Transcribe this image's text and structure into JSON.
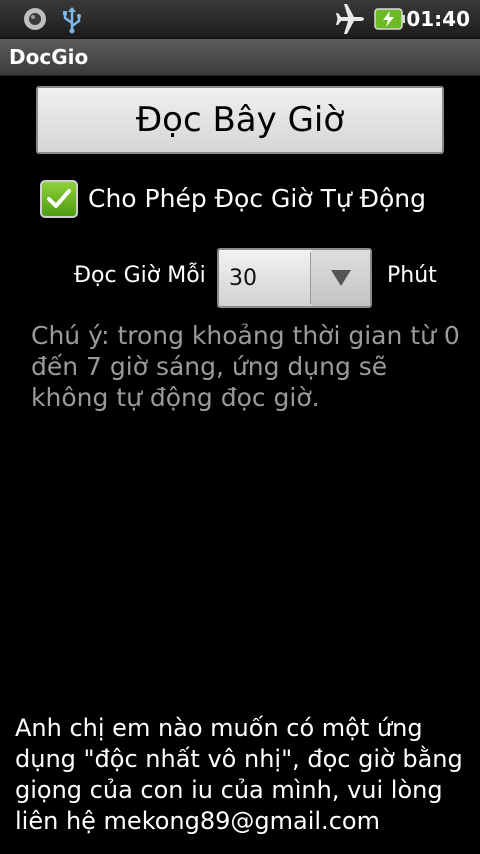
{
  "status_bar": {
    "time": "01:40"
  },
  "app": {
    "title": "DocGio"
  },
  "main": {
    "read_now_label": "Đọc Bây Giờ",
    "auto_read_label": "Cho Phép Đọc Giờ Tự Động",
    "auto_read_checked": true,
    "interval_label": "Đọc Giờ Mỗi",
    "interval_value": "30",
    "interval_unit": "Phút",
    "note": "Chú ý: trong khoảng thời gian từ 0 đến 7 giờ sáng, ứng dụng sẽ không tự động đọc giờ.",
    "contact": "Anh chị em nào muốn có một ứng dụng \"độc nhất vô nhị\", đọc giờ bằng giọng của con iu của mình, vui lòng liên hệ mekong89@gmail.com"
  },
  "icons": {
    "status_left": [
      "camera-icon",
      "usb-icon"
    ],
    "status_right": [
      "airplane-mode-icon",
      "battery-charging-icon"
    ]
  },
  "colors": {
    "background": "#000000",
    "checkbox_green": "#6cbb25",
    "note_gray": "#9a9a9a"
  }
}
